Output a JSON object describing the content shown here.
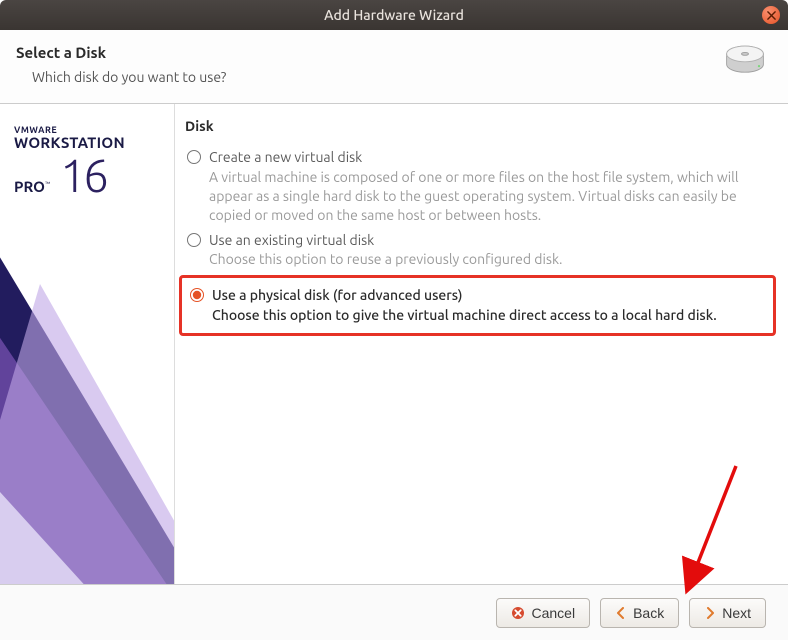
{
  "window": {
    "title": "Add Hardware Wizard"
  },
  "header": {
    "title": "Select a Disk",
    "subtitle": "Which disk do you want to use?"
  },
  "branding": {
    "vmware": "VMWARE",
    "workstation": "WORKSTATION",
    "pro": "PRO",
    "tm": "™",
    "version": "16"
  },
  "section_title": "Disk",
  "options": [
    {
      "label": "Create a new virtual disk",
      "desc": "A virtual machine is composed of one or more files on the host file system, which will appear as a single hard disk to the guest operating system. Virtual disks can easily be copied or moved on the same host or between hosts.",
      "selected": false
    },
    {
      "label": "Use an existing virtual disk",
      "desc": "Choose this option to reuse a previously configured disk.",
      "selected": false
    },
    {
      "label": "Use a physical disk (for advanced users)",
      "desc": "Choose this option to give the virtual machine direct access to a local hard disk.",
      "selected": true
    }
  ],
  "buttons": {
    "cancel": "Cancel",
    "back": "Back",
    "next": "Next"
  }
}
